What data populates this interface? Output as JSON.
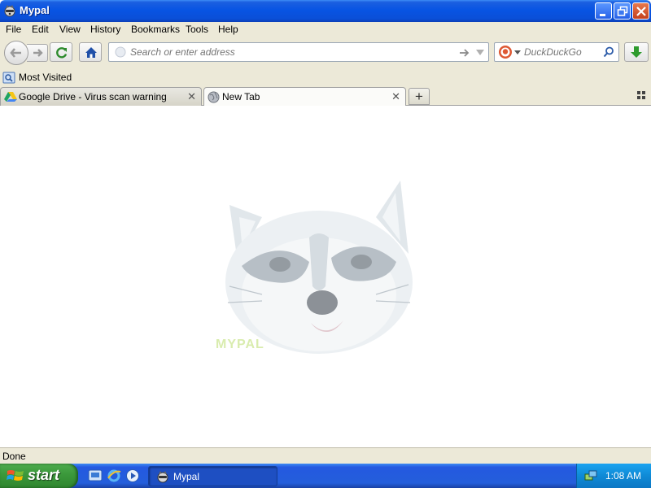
{
  "window": {
    "title": "Mypal"
  },
  "menu": {
    "items": [
      "File",
      "Edit",
      "View",
      "History",
      "Bookmarks",
      "Tools",
      "Help"
    ]
  },
  "navbar": {
    "url_placeholder": "Search or enter address",
    "search_placeholder": "DuckDuckGo"
  },
  "bookmarks": {
    "items": [
      {
        "label": "Most Visited",
        "icon": "folder-icon"
      }
    ]
  },
  "tabs": [
    {
      "label": "Google Drive - Virus scan warning",
      "icon": "google-drive-icon",
      "active": false
    },
    {
      "label": "New Tab",
      "icon": "globe-icon",
      "active": true
    }
  ],
  "content": {
    "logo_text": "MYPAL"
  },
  "status": {
    "text": "Done"
  },
  "taskbar": {
    "start_label": "start",
    "task_label": "Mypal",
    "clock": "1:08 AM"
  },
  "colors": {
    "titlebar": "#0854e3",
    "chrome": "#ece9d8",
    "taskbar": "#245edb",
    "start": "#3c9a3c",
    "download_arrow": "#2e9b2e"
  }
}
